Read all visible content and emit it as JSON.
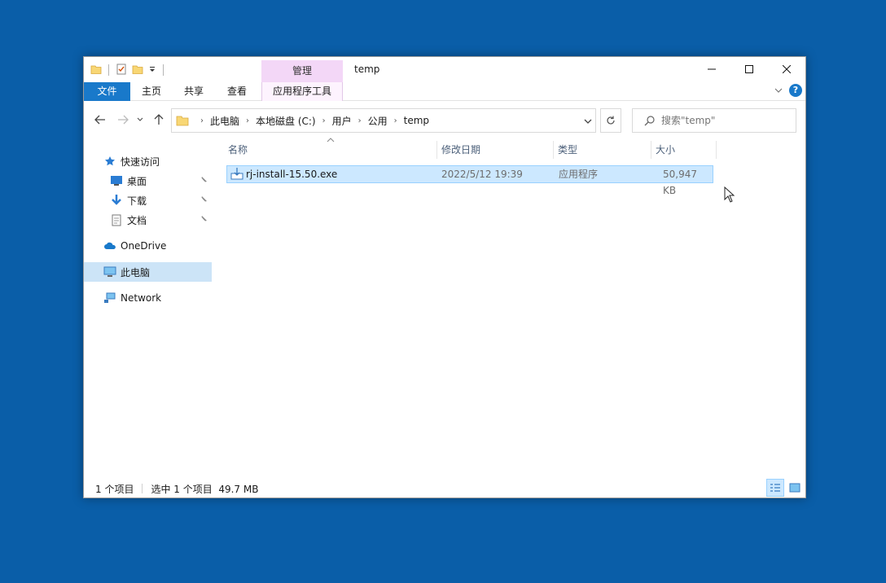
{
  "window": {
    "title": "temp",
    "context_tab_header": "管理",
    "ribbon_tabs": [
      "文件",
      "主页",
      "共享",
      "查看",
      "应用程序工具"
    ]
  },
  "address": {
    "crumbs": [
      "此电脑",
      "本地磁盘 (C:)",
      "用户",
      "公用",
      "temp"
    ]
  },
  "search": {
    "placeholder": "搜索\"temp\""
  },
  "navpane": {
    "quick_access": "快速访问",
    "quick_items": [
      "桌面",
      "下载",
      "文档"
    ],
    "onedrive": "OneDrive",
    "this_pc": "此电脑",
    "network": "Network"
  },
  "columns": {
    "name": "名称",
    "modified": "修改日期",
    "type": "类型",
    "size": "大小"
  },
  "files": [
    {
      "name": "rj-install-15.50.exe",
      "modified": "2022/5/12 19:39",
      "type": "应用程序",
      "size": "50,947 KB"
    }
  ],
  "status": {
    "count": "1 个项目",
    "selection": "选中 1 个项目  49.7 MB"
  },
  "colors": {
    "desktop": "#0a5ea8",
    "accent": "#1979ca",
    "selection": "#cce8ff",
    "context_tab": "#f3d7f7"
  }
}
